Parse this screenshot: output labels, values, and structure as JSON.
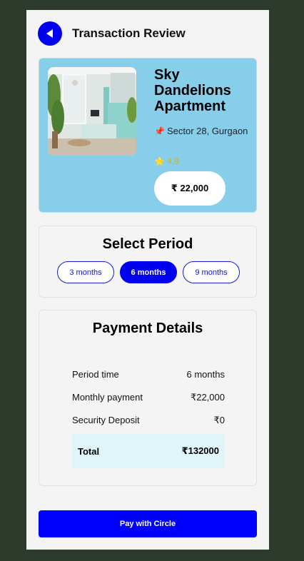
{
  "header": {
    "title": "Transaction Review",
    "back_icon": "back-arrow-icon"
  },
  "property": {
    "name": "Sky Dandelions Apartment",
    "location": "Sector 28, Gurgaon",
    "location_icon": "pin-icon",
    "rating_icon": "star-icon",
    "rating": "4.9",
    "price": "₹ 22,000"
  },
  "period": {
    "title": "Select Period",
    "options": [
      {
        "label": "3 months",
        "selected": false
      },
      {
        "label": "6 months",
        "selected": true
      },
      {
        "label": "9 months",
        "selected": false
      }
    ]
  },
  "payment": {
    "title": "Payment Details",
    "rows": [
      {
        "label": "Period time",
        "value": "6 months"
      },
      {
        "label": "Monthly payment",
        "value": "₹22,000"
      },
      {
        "label": "Security Deposit",
        "value": "₹0"
      }
    ],
    "total_label": "Total",
    "total_value": "₹132000"
  },
  "pay_button": {
    "label": "Pay with Circle"
  },
  "colors": {
    "accent": "#0000f0",
    "property_card_bg": "#87ceeb",
    "total_bg": "#dff5f7",
    "page_bg": "#2d3b2d",
    "rating": "#e0b000"
  }
}
